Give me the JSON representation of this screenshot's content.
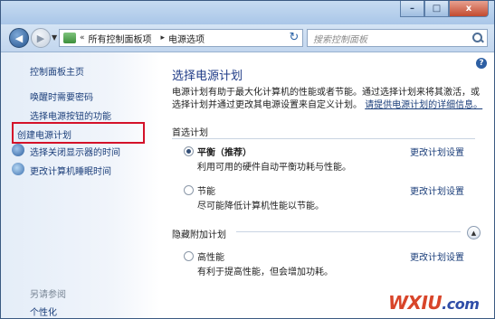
{
  "window": {
    "caption_buttons": {
      "minimize": "–",
      "maximize": "□",
      "close": "x"
    }
  },
  "nav": {
    "back_glyph": "◀",
    "forward_glyph": "▶",
    "breadcrumb": [
      "所有控制面板项",
      "电源选项"
    ],
    "breadcrumb_prefix": "«",
    "breadcrumb_separator": "▸",
    "refresh_glyph": "↻",
    "search_placeholder": "搜索控制面板"
  },
  "sidebar": {
    "items": [
      {
        "label": "控制面板主页"
      },
      {
        "label": "唤醒时需要密码"
      },
      {
        "label": "选择电源按钮的功能"
      },
      {
        "label": "创建电源计划"
      },
      {
        "label": "选择关闭显示器的时间"
      },
      {
        "label": "更改计算机睡眠时间"
      }
    ],
    "see_also": "另请参阅",
    "see_also_items": [
      {
        "label": "个性化"
      }
    ]
  },
  "main": {
    "help_glyph": "?",
    "title": "选择电源计划",
    "description_1": "电源计划有助于最大化计算机的性能或者节能。通过选择计划来将其激活，或",
    "description_2": "选择计划并通过更改其电源设置来自定义计划。",
    "description_link": "请提供电源计划的详细信息。",
    "preferred_heading": "首选计划",
    "hidden_heading": "隐藏附加计划",
    "plans": [
      {
        "name": "平衡（推荐）",
        "desc": "利用可用的硬件自动平衡功耗与性能。",
        "link": "更改计划设置",
        "selected": true
      },
      {
        "name": "节能",
        "desc": "尽可能降低计算机性能以节能。",
        "link": "更改计划设置",
        "selected": false
      },
      {
        "name": "高性能",
        "desc": "有利于提高性能，但会增加功耗。",
        "link": "更改计划设置",
        "selected": false
      }
    ],
    "expand_glyph": "▲"
  },
  "watermark": {
    "text": "WXIU",
    "suffix": ".com"
  },
  "colors": {
    "link": "#1b3e7a",
    "title": "#1e3a86",
    "highlight_box": "#d4122a"
  }
}
